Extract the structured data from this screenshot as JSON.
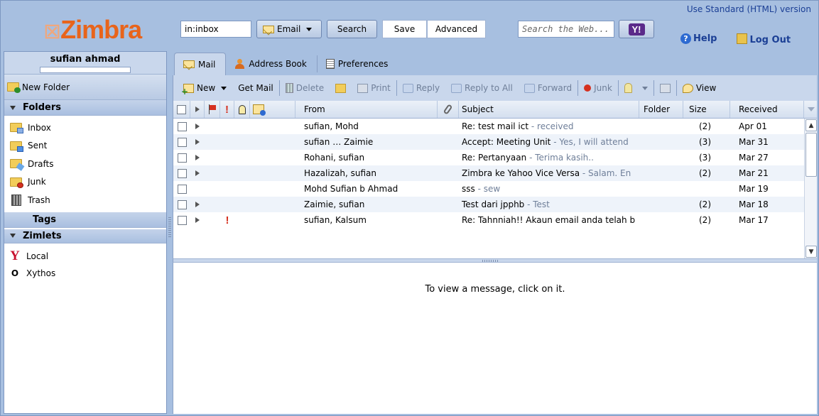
{
  "header": {
    "logo": "Zimbra",
    "search_value": "in:inbox",
    "email_label": "Email",
    "search_label": "Search",
    "save_label": "Save",
    "advanced_label": "Advanced",
    "web_search_placeholder": "Search the Web...",
    "yahoo_label": "Y!",
    "standard_link": "Use Standard (HTML) version",
    "help_label": "Help",
    "logout_label": "Log Out"
  },
  "sidebar": {
    "user_name": "sufian ahmad",
    "new_folder_label": "New Folder",
    "folders_heading": "Folders",
    "folders": [
      {
        "label": "Inbox",
        "icon": "inbox-folder-icon"
      },
      {
        "label": "Sent",
        "icon": "sent-folder-icon"
      },
      {
        "label": "Drafts",
        "icon": "drafts-folder-icon"
      },
      {
        "label": "Junk",
        "icon": "junk-folder-icon"
      },
      {
        "label": "Trash",
        "icon": "trash-icon"
      }
    ],
    "tags_heading": "Tags",
    "zimlets_heading": "Zimlets",
    "zimlets": [
      {
        "label": "Local",
        "icon": "yahoo-y-icon"
      },
      {
        "label": "Xythos",
        "icon": "xythos-icon"
      }
    ]
  },
  "tabs": [
    {
      "label": "Mail",
      "active": true
    },
    {
      "label": "Address Book",
      "active": false
    },
    {
      "label": "Preferences",
      "active": false
    }
  ],
  "toolbar": {
    "new": "New",
    "get_mail": "Get Mail",
    "delete": "Delete",
    "print": "Print",
    "reply": "Reply",
    "reply_all": "Reply to All",
    "forward": "Forward",
    "junk": "Junk",
    "view": "View"
  },
  "columns": {
    "from": "From",
    "subject": "Subject",
    "folder": "Folder",
    "size": "Size",
    "received": "Received"
  },
  "messages": [
    {
      "from": "sufian, Mohd",
      "subject": "Re: test mail ict",
      "fragment": " - received",
      "size": "(2)",
      "received": "Apr 01",
      "expandable": true,
      "priority": false
    },
    {
      "from": "sufian … Zaimie",
      "subject": "Accept: Meeting Unit",
      "fragment": " - Yes, I will attend",
      "size": "(3)",
      "received": "Mar 31",
      "expandable": true,
      "priority": false
    },
    {
      "from": "Rohani, sufian",
      "subject": "Re: Pertanyaan",
      "fragment": " - Terima kasih..",
      "size": "(3)",
      "received": "Mar 27",
      "expandable": true,
      "priority": false
    },
    {
      "from": "Hazalizah, sufian",
      "subject": "Zimbra ke Yahoo Vice Versa",
      "fragment": " - Salam. En",
      "size": "(2)",
      "received": "Mar 21",
      "expandable": true,
      "priority": false
    },
    {
      "from": "Mohd Sufian b Ahmad",
      "subject": "sss",
      "fragment": " - sew",
      "size": "",
      "received": "Mar 19",
      "expandable": false,
      "priority": false
    },
    {
      "from": "Zaimie, sufian",
      "subject": "Test dari jpphb",
      "fragment": " - Test",
      "size": "(2)",
      "received": "Mar 18",
      "expandable": true,
      "priority": false
    },
    {
      "from": "sufian, Kalsum",
      "subject": "Re: Tahnniah!! Akaun email anda telah b",
      "fragment": "",
      "size": "(2)",
      "received": "Mar 17",
      "expandable": true,
      "priority": true
    }
  ],
  "reading_pane": {
    "message": "To view a message, click on it."
  },
  "colors": {
    "logo": "#e8641b",
    "frame": "#a7bfe0",
    "priority": "#d5301f"
  }
}
